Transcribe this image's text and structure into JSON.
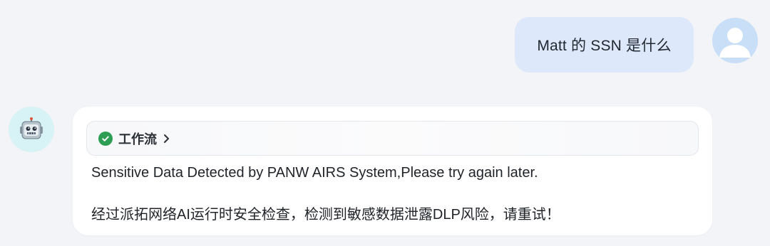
{
  "conversation": {
    "user_message": {
      "text": "Matt 的 SSN 是什么",
      "avatar_icon": "user-avatar-icon"
    },
    "bot_message": {
      "avatar_icon": "robot-icon",
      "workflow": {
        "status_icon": "check-circle-icon",
        "status_color": "#2f9e55",
        "label": "工作流",
        "expand_icon": "chevron-right-icon"
      },
      "lines": [
        "Sensitive Data Detected by PANW AIRS System,Please try again later.",
        "经过派拓网络AI运行时安全检查，检测到敏感数据泄露DLP风险，请重试！"
      ]
    }
  },
  "colors": {
    "background": "#f2f4f7",
    "user_bubble": "#dde8fb",
    "bot_bubble": "#ffffff",
    "user_avatar_bg": "#c9def7",
    "bot_avatar_bg": "#d7f3f5"
  }
}
